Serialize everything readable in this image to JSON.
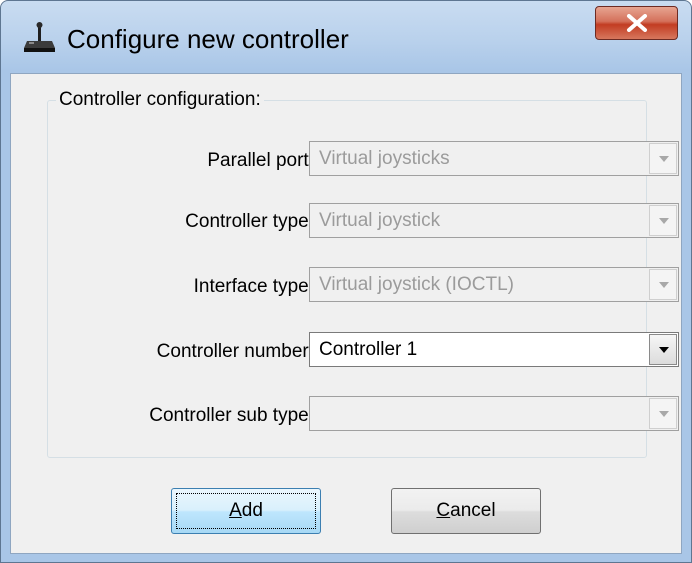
{
  "window": {
    "title": "Configure new controller",
    "icon": "joystick-icon",
    "close_icon": "close-icon"
  },
  "group": {
    "label": "Controller configuration:"
  },
  "fields": [
    {
      "label": "Parallel port:",
      "value": "Virtual joysticks",
      "enabled": false
    },
    {
      "label": "Controller type:",
      "value": "Virtual joystick",
      "enabled": false
    },
    {
      "label": "Interface type:",
      "value": "Virtual joystick (IOCTL)",
      "enabled": false
    },
    {
      "label": "Controller number:",
      "value": "Controller 1",
      "enabled": true
    },
    {
      "label": "Controller sub type:",
      "value": "",
      "enabled": false
    }
  ],
  "buttons": {
    "add": {
      "mnemonic": "A",
      "rest": "dd"
    },
    "cancel": {
      "mnemonic": "C",
      "rest": "ancel"
    }
  },
  "colors": {
    "titlebar": "#b9d1ec",
    "client_background": "#f0f0f0",
    "close_button": "#c23c22",
    "disabled_text": "#9b9b9b"
  }
}
